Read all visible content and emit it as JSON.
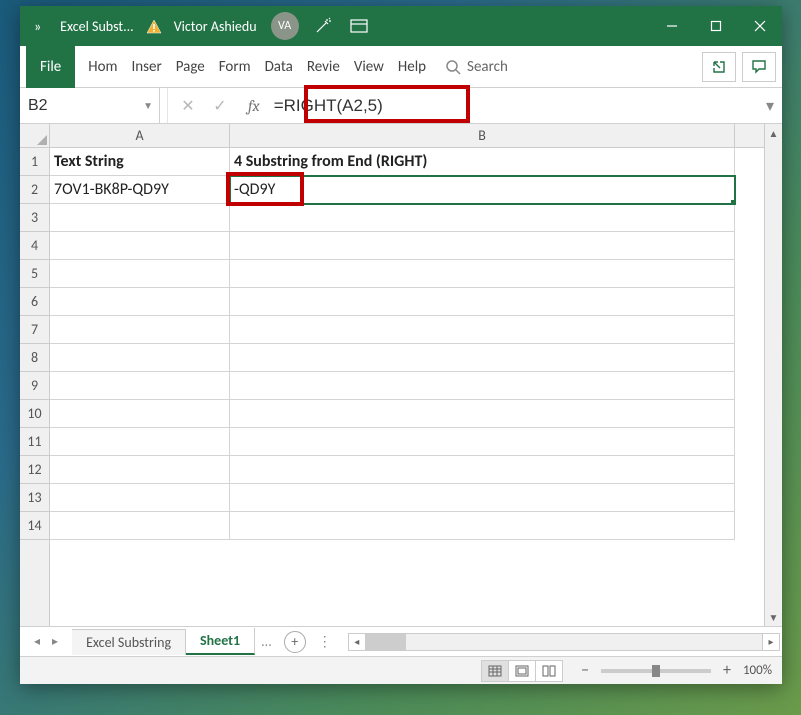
{
  "titlebar": {
    "more": "»",
    "doc_title": "Excel Subst...",
    "user_name": "Victor Ashiedu",
    "avatar_initials": "VA"
  },
  "ribbon": {
    "tabs": {
      "file": "File",
      "home": "Hom",
      "insert": "Inser",
      "page": "Page",
      "formulas": "Form",
      "data": "Data",
      "review": "Revie",
      "view": "View",
      "help": "Help"
    },
    "search": "Search"
  },
  "formula": {
    "cell_ref": "B2",
    "fx_label": "fx",
    "value": "=RIGHT(A2,5)"
  },
  "columns": [
    "A",
    "B"
  ],
  "rows": [
    "1",
    "2",
    "3",
    "4",
    "5",
    "6",
    "7",
    "8",
    "9",
    "10",
    "11",
    "12",
    "13",
    "14"
  ],
  "cells": {
    "A1": "Text String",
    "B1": "4 Substring from End (RIGHT)",
    "A2": "7OV1-BK8P-QD9Y",
    "B2": "-QD9Y"
  },
  "sheets": {
    "nav_prev": "◂",
    "nav_next": "▸",
    "tab1": "Excel Substring",
    "tab2": "Sheet1",
    "ellipsis": "...",
    "add": "+"
  },
  "status": {
    "zoom": "100%"
  },
  "chart_data": {
    "type": "table",
    "columns": [
      "Text String",
      "4 Substring from End (RIGHT)"
    ],
    "rows": [
      [
        "7OV1-BK8P-QD9Y",
        "-QD9Y"
      ]
    ],
    "selected_cell": "B2",
    "formula": "=RIGHT(A2,5)"
  }
}
